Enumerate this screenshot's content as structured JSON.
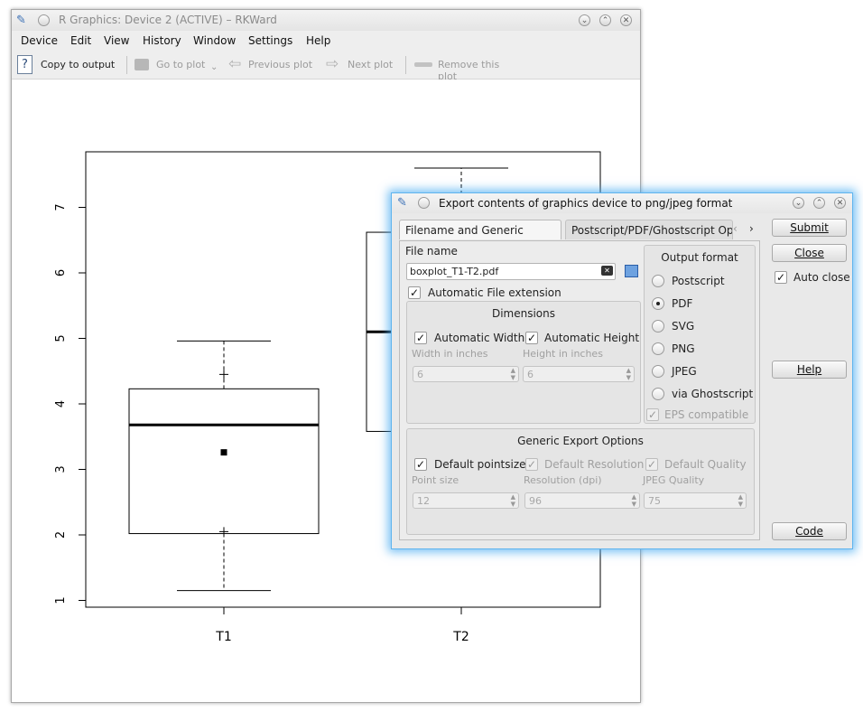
{
  "main_window": {
    "title": "R Graphics: Device 2 (ACTIVE) – RKWard",
    "menu": [
      "Device",
      "Edit",
      "View",
      "History",
      "Window",
      "Settings",
      "Help"
    ],
    "toolbar": {
      "copy_to_output": "Copy to output",
      "go_to_plot": "Go to plot",
      "previous_plot": "Previous plot",
      "next_plot": "Next plot",
      "remove_plot": "Remove this plot"
    }
  },
  "chart_data": {
    "type": "boxplot",
    "categories": [
      "T1",
      "T2"
    ],
    "y_ticks": [
      "1",
      "2",
      "3",
      "4",
      "5",
      "6",
      "7"
    ],
    "ylim": [
      0.9,
      7.9
    ],
    "boxes": [
      {
        "name": "T1",
        "whisker_low": 1.15,
        "q1": 2.02,
        "median": 3.68,
        "q3": 4.23,
        "whisker_high": 4.96,
        "mean": 3.26,
        "extra_points": [
          2.05,
          4.45
        ]
      },
      {
        "name": "T2",
        "q1": 3.58,
        "median": 5.1,
        "q3": 6.62,
        "whisker_high": 7.6
      }
    ]
  },
  "dialog": {
    "title": "Export contents of graphics device to png/jpeg format",
    "tabs": [
      "Filename and Generic options",
      "Postscript/PDF/Ghostscript Op"
    ],
    "file_name_label": "File name",
    "file_name_value": "boxplot_T1-T2.pdf",
    "auto_extension": "Automatic File extension",
    "dimensions": {
      "title": "Dimensions",
      "auto_width": "Automatic Width",
      "auto_height": "Automatic Height",
      "width_label": "Width in inches",
      "height_label": "Height in inches",
      "width_value": "6",
      "height_value": "6"
    },
    "output_format": {
      "title": "Output format",
      "options": [
        "Postscript",
        "PDF",
        "SVG",
        "PNG",
        "JPEG",
        "via Ghostscript"
      ],
      "selected": "PDF",
      "eps_compatible": "EPS compatible"
    },
    "generic": {
      "title": "Generic Export Options",
      "default_pointsize": "Default pointsize",
      "default_resolution": "Default Resolution",
      "default_quality": "Default Quality",
      "point_size_label": "Point size",
      "resolution_label": "Resolution (dpi)",
      "quality_label": "JPEG Quality",
      "point_size_value": "12",
      "resolution_value": "96",
      "quality_value": "75"
    },
    "buttons": {
      "submit": "Submit",
      "close": "Close",
      "auto_close": "Auto close",
      "help": "Help",
      "code": "Code"
    }
  }
}
